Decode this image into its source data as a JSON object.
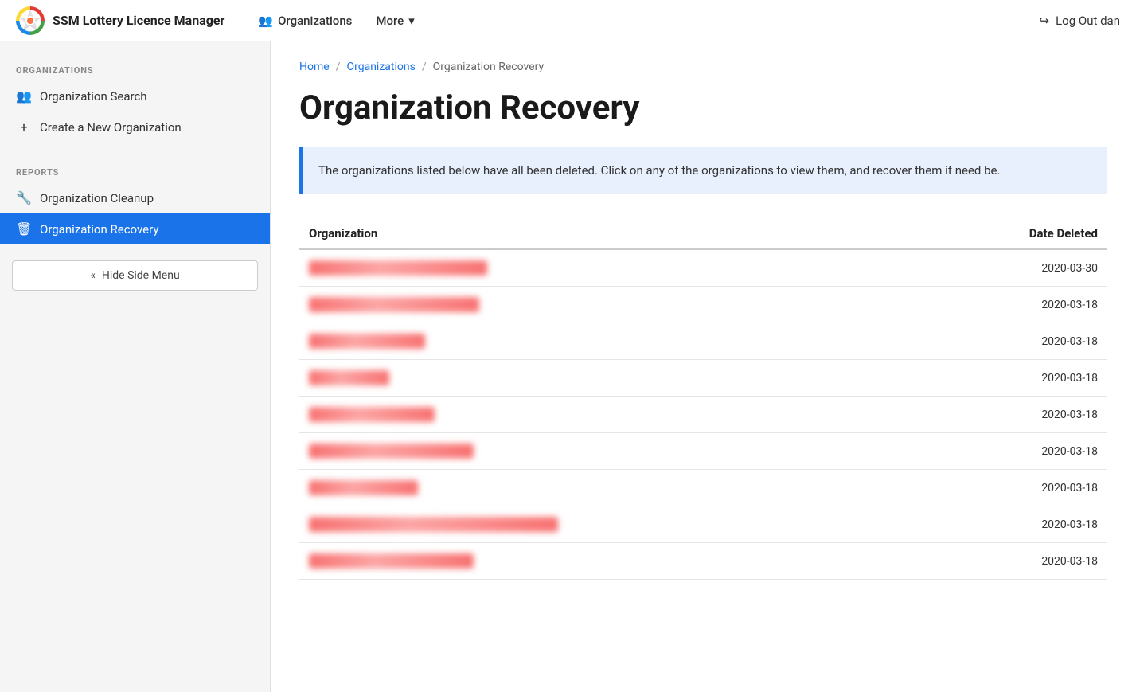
{
  "app": {
    "title": "SSM Lottery Licence Manager",
    "logout_label": "Log Out dan"
  },
  "topnav": {
    "organizations_label": "Organizations",
    "more_label": "More"
  },
  "sidebar": {
    "section_organizations": "ORGANIZATIONS",
    "section_reports": "REPORTS",
    "items": [
      {
        "id": "org-search",
        "label": "Organization Search",
        "icon": "👥"
      },
      {
        "id": "create-org",
        "label": "Create a New Organization",
        "icon": "+"
      }
    ],
    "report_items": [
      {
        "id": "org-cleanup",
        "label": "Organization Cleanup",
        "icon": "🔧"
      },
      {
        "id": "org-recovery",
        "label": "Organization Recovery",
        "icon": "🗑"
      }
    ],
    "hide_menu_label": "Hide Side Menu"
  },
  "breadcrumb": {
    "home": "Home",
    "organizations": "Organizations",
    "current": "Organization Recovery"
  },
  "page": {
    "title": "Organization Recovery",
    "info_text": "The organizations listed below have all been deleted. Click on any of the organizations to view them, and recover them if need be."
  },
  "table": {
    "col_organization": "Organization",
    "col_date_deleted": "Date Deleted",
    "rows": [
      {
        "name": "XXXXXXX XXXX XXXXXXXX XXXXX",
        "date": "2020-03-30"
      },
      {
        "name": "XXXX XXXXXX XX XXX X XXXXXX",
        "date": "2020-03-18"
      },
      {
        "name": "XXXXXXXX XXXXXXXX",
        "date": "2020-03-18"
      },
      {
        "name": "XXXXXX XXXXX",
        "date": "2020-03-18"
      },
      {
        "name": "XXXXXX XXXXX XXXXXX",
        "date": "2020-03-18"
      },
      {
        "name": "XXXXXXXXX XXXXX XXXXXX XX",
        "date": "2020-03-18"
      },
      {
        "name": "XXXXX XXXXXXXXXX",
        "date": "2020-03-18"
      },
      {
        "name": "XXXXX XXXXXXXXXX XXXXXXXXXXXXXX XXXXX",
        "date": "2020-03-18"
      },
      {
        "name": "XXXXXXX XXXXXXXXXX XX XXX",
        "date": "2020-03-18"
      }
    ]
  }
}
